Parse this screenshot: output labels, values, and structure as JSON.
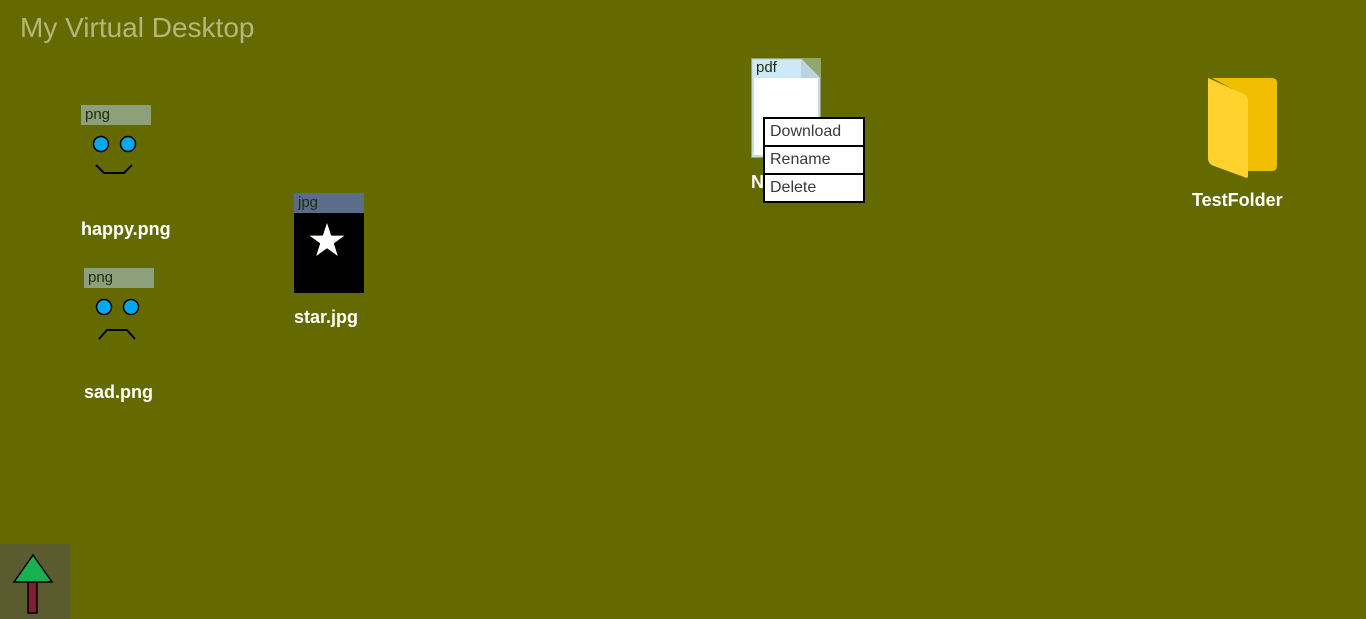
{
  "desktop": {
    "title": "My Virtual Desktop",
    "background": "#646900"
  },
  "files": [
    {
      "name": "happy.png",
      "ext": "png",
      "icon": "happy-face-icon"
    },
    {
      "name": "sad.png",
      "ext": "png",
      "icon": "sad-face-icon"
    },
    {
      "name": "star.jpg",
      "ext": "jpg",
      "icon": "star-icon"
    },
    {
      "name": "N",
      "ext": "pdf",
      "icon": "document-icon"
    },
    {
      "name": "TestFolder",
      "ext": "",
      "icon": "folder-icon"
    }
  ],
  "context_menu": {
    "items": [
      "Download",
      "Rename",
      "Delete"
    ]
  },
  "navigation": {
    "up_icon": "up-arrow-tree-icon"
  },
  "colors": {
    "png_tab": "#8ca07a",
    "jpg_tab": "#5a6e8a",
    "pdf_tab": "#cde9f7",
    "folder": "#ffd02e",
    "face_eye": "#00a8f0",
    "tree_top": "#1aaf50",
    "tree_trunk": "#7a2030"
  }
}
